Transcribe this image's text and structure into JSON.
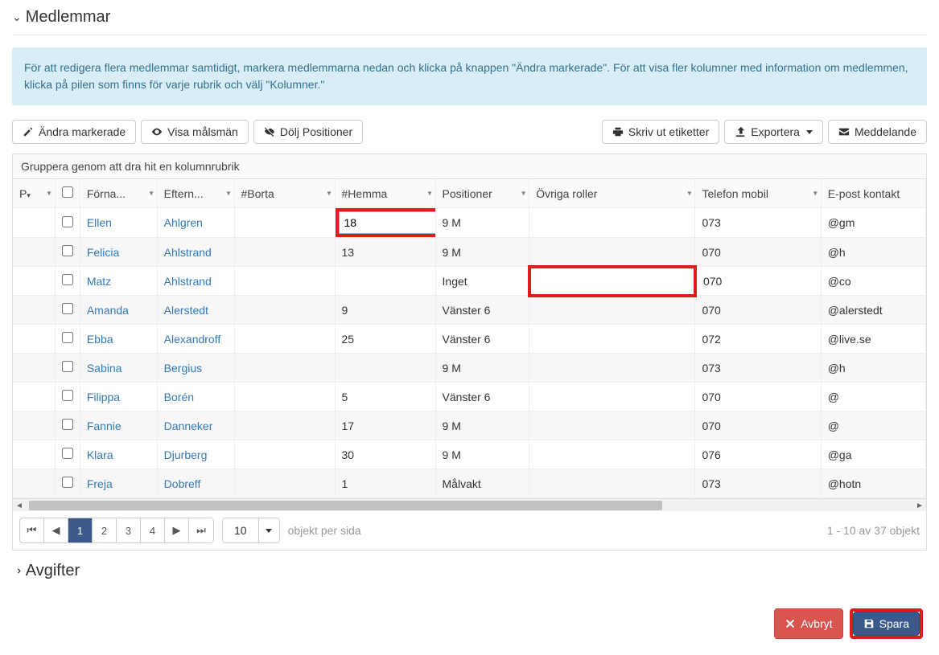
{
  "sections": {
    "members": "Medlemmar",
    "fees": "Avgifter"
  },
  "info": "För att redigera flera medlemmar samtidigt, markera medlemmarna nedan och klicka på knappen \"Ändra markerade\". För att visa fler kolumner med information om medlemmen, klicka på pilen som finns för varje rubrik och välj \"Kolumner.\"",
  "toolbar": {
    "edit_selected": "Ändra markerade",
    "show_guardians": "Visa målsmän",
    "hide_positions": "Dölj Positioner",
    "print_labels": "Skriv ut etiketter",
    "export": "Exportera",
    "message": "Meddelande"
  },
  "group_hint": "Gruppera genom att dra hit en kolumnrubrik",
  "columns": {
    "p": "P",
    "firstname": "Förna...",
    "lastname": "Eftern...",
    "away": "#Borta",
    "home": "#Hemma",
    "positions": "Positioner",
    "roles": "Övriga roller",
    "phone": "Telefon mobil",
    "email": "E-post kontakt"
  },
  "edit_value": "18",
  "rows": [
    {
      "first": "Ellen",
      "last": "Ahlgren",
      "away": "",
      "home": "",
      "pos": "9 M",
      "roles": "",
      "phone": "073",
      "email": "@gm"
    },
    {
      "first": "Felicia",
      "last": "Ahlstrand",
      "away": "",
      "home": "13",
      "pos": "9 M",
      "roles": "",
      "phone": "070",
      "email": "@h"
    },
    {
      "first": "Matz",
      "last": "Ahlstrand",
      "away": "",
      "home": "",
      "pos": "Inget",
      "roles": "",
      "phone": "070",
      "email": "@co"
    },
    {
      "first": "Amanda",
      "last": "Alerstedt",
      "away": "",
      "home": "9",
      "pos": "Vänster 6",
      "roles": "",
      "phone": "070",
      "email": "@alerstedt"
    },
    {
      "first": "Ebba",
      "last": "Alexandroff",
      "away": "",
      "home": "25",
      "pos": "Vänster 6",
      "roles": "",
      "phone": "072",
      "email": "@live.se"
    },
    {
      "first": "Sabina",
      "last": "Bergius",
      "away": "",
      "home": "",
      "pos": "9 M",
      "roles": "",
      "phone": "073",
      "email": "@h"
    },
    {
      "first": "Filippa",
      "last": "Borén",
      "away": "",
      "home": "5",
      "pos": "Vänster 6",
      "roles": "",
      "phone": "070",
      "email": "@"
    },
    {
      "first": "Fannie",
      "last": "Danneker",
      "away": "",
      "home": "17",
      "pos": "9 M",
      "roles": "",
      "phone": "070",
      "email": "@"
    },
    {
      "first": "Klara",
      "last": "Djurberg",
      "away": "",
      "home": "30",
      "pos": "9 M",
      "roles": "",
      "phone": "076",
      "email": "@ga"
    },
    {
      "first": "Freja",
      "last": "Dobreff",
      "away": "",
      "home": "1",
      "pos": "Målvakt",
      "roles": "",
      "phone": "073",
      "email": "@hotn"
    }
  ],
  "pager": {
    "pages": [
      "1",
      "2",
      "3",
      "4"
    ],
    "active": 0,
    "pagesize": "10",
    "per_page_label": "objekt per sida",
    "info": "1 - 10 av 37 objekt"
  },
  "footer": {
    "cancel": "Avbryt",
    "save": "Spara"
  }
}
